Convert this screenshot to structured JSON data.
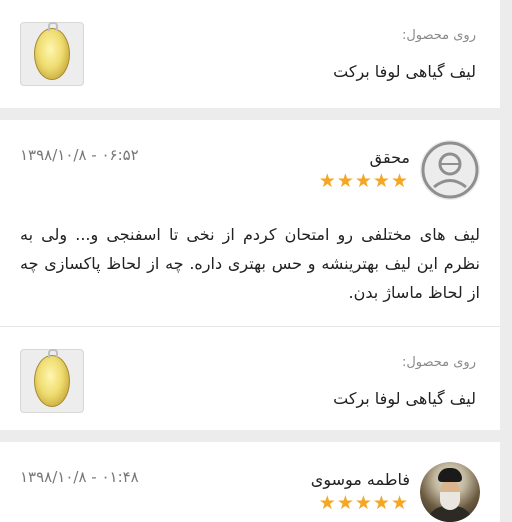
{
  "product_cards": [
    {
      "label": "روی محصول:",
      "name": "لیف گیاهی لوفا برکت"
    },
    {
      "label": "روی محصول:",
      "name": "لیف گیاهی لوفا برکت"
    }
  ],
  "reviews": [
    {
      "author": "محقق",
      "date": "۱۳۹۸/۱۰/۸ - ۰۶:۵۲",
      "rating": 5,
      "text": "لیف های مختلفی رو امتحان کردم از نخی تا اسفنجی و... ولی به نظرم این لیف بهترینشه و حس بهتری داره. چه از لحاظ پاکسازی چه از لحاظ ماساژ بدن."
    },
    {
      "author": "فاطمه موسوی",
      "date": "۱۳۹۸/۱۰/۸ - ۰۱:۴۸",
      "rating": 5,
      "text": ""
    }
  ],
  "icons": {
    "default_avatar": "user-circle-icon",
    "star": "star-icon"
  },
  "colors": {
    "star": "#f5a623",
    "background": "#ececec",
    "card": "#ffffff"
  }
}
